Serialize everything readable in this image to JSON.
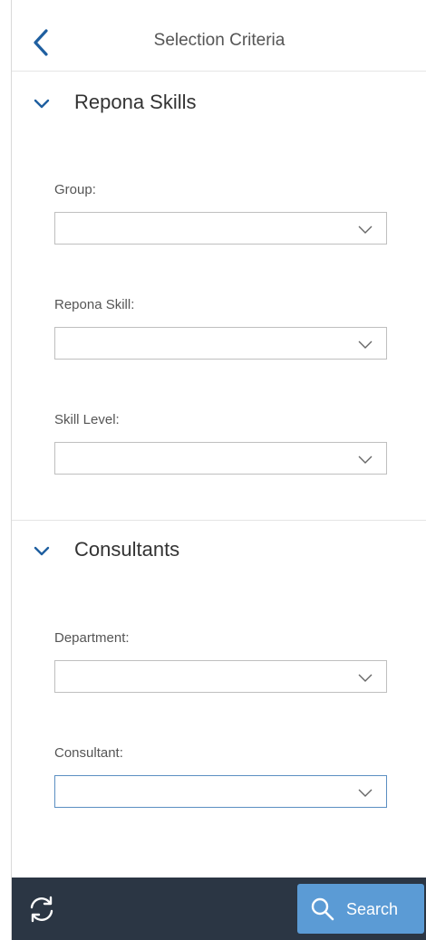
{
  "header": {
    "title": "Selection Criteria",
    "back_icon": "chevron-left-icon"
  },
  "sections": [
    {
      "title": "Repona Skills",
      "expanded": true,
      "fields": [
        {
          "label": "Group:",
          "value": ""
        },
        {
          "label": "Repona Skill:",
          "value": ""
        },
        {
          "label": "Skill Level:",
          "value": ""
        }
      ]
    },
    {
      "title": "Consultants",
      "expanded": true,
      "fields": [
        {
          "label": "Department:",
          "value": ""
        },
        {
          "label": "Consultant:",
          "value": ""
        }
      ]
    }
  ],
  "footer": {
    "refresh_icon": "refresh-icon",
    "search_label": "Search",
    "search_icon": "search-icon"
  },
  "colors": {
    "accent": "#5b9bd5",
    "footer_bg": "#2b3644",
    "focus_border": "#5b8fc2",
    "back_icon": "#1f5fa0"
  }
}
